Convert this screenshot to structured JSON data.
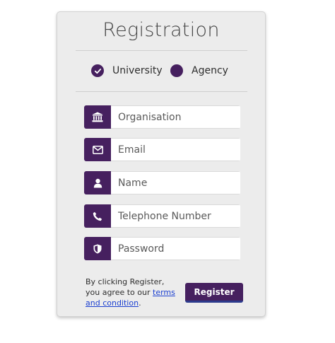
{
  "title": "Registration",
  "account_type": {
    "options": [
      {
        "label": "University",
        "checked": true
      },
      {
        "label": "Agency",
        "checked": false
      }
    ]
  },
  "fields": {
    "organisation": {
      "placeholder": "Organisation",
      "icon": "bank-icon"
    },
    "email": {
      "placeholder": "Email",
      "icon": "envelope-icon"
    },
    "name": {
      "placeholder": "Name",
      "icon": "user-icon"
    },
    "telephone": {
      "placeholder": "Telephone Number",
      "icon": "phone-icon"
    },
    "password": {
      "placeholder": "Password",
      "icon": "shield-icon"
    }
  },
  "terms": {
    "prefix": "By clicking Register, you agree to our ",
    "link": "terms and condition",
    "suffix": "."
  },
  "register_label": "Register",
  "colors": {
    "accent": "#46205f",
    "card_bg": "#ececec",
    "link": "#1a3fd0"
  }
}
